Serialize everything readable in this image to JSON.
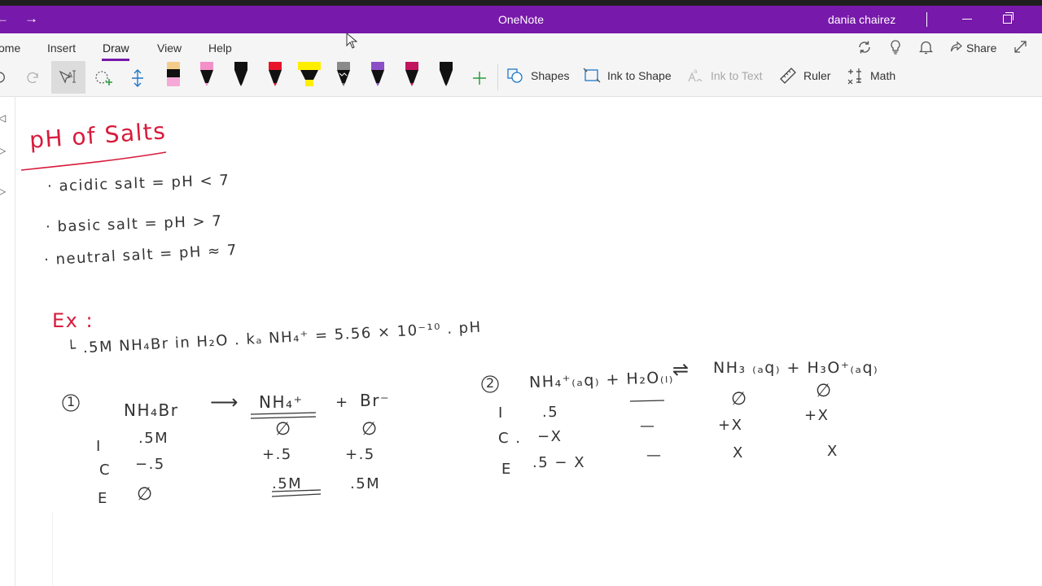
{
  "window": {
    "app_title": "OneNote",
    "user_name": "dania chairez"
  },
  "tabs": [
    {
      "label": "ome"
    },
    {
      "label": "Insert"
    },
    {
      "label": "Draw"
    },
    {
      "label": "View"
    },
    {
      "label": "Help"
    }
  ],
  "ribbon": {
    "share_label": "Share"
  },
  "tools": {
    "shapes": "Shapes",
    "ink_to_shape": "Ink to Shape",
    "ink_to_text": "Ink to Text",
    "ruler": "Ruler",
    "math": "Math"
  },
  "pens": [
    {
      "name": "highlighter-pink-yellow",
      "color": "#f6a8d6"
    },
    {
      "name": "pen-pink",
      "color": "#f48fc8"
    },
    {
      "name": "pen-black",
      "color": "#111111"
    },
    {
      "name": "pen-red",
      "color": "#e8142a"
    },
    {
      "name": "highlighter-yellow",
      "color": "#ffee00"
    },
    {
      "name": "pen-galaxy",
      "color": "#888888"
    },
    {
      "name": "pen-purple",
      "color": "#8b4fc7"
    },
    {
      "name": "pen-magenta",
      "color": "#c1155e"
    },
    {
      "name": "pen-black-2",
      "color": "#111111"
    }
  ],
  "notes": {
    "title": "pH of Salts",
    "line_acidic": "· acidic salt = pH < 7",
    "line_basic": "· basic salt = pH > 7",
    "line_neutral": "· neutral salt = pH ≈ 7",
    "ex_label": "Ex :",
    "problem": "└ .5M NH₄Br in H₂O .  kₐ NH₄⁺ = 5.56 × 10⁻¹⁰ .  pH",
    "step1_num": "1",
    "step1_reactant": "NH₄Br",
    "step1_arrow": "⟶",
    "step1_product1": "NH₄⁺",
    "step1_plus": "+",
    "step1_product2": "Br⁻",
    "ice1_i": "I",
    "ice1_c": "C",
    "ice1_e": "E",
    "ice1_i_val": ".5M",
    "ice1_c_val": "−.5",
    "ice1_e_val": "∅",
    "ice1_nh4_i": "∅",
    "ice1_nh4_c": "+.5",
    "ice1_nh4_e": ".5M",
    "ice1_br_i": "∅",
    "ice1_br_c": "+.5",
    "ice1_br_e": ".5M",
    "step2_num": "2",
    "step2_eq_left": "NH₄⁺₍ₐq₎ + H₂O₍ₗ₎",
    "step2_eq_arrow": "⇌",
    "step2_eq_right": "NH₃ ₍ₐq₎ + H₃O⁺₍ₐq₎",
    "ice2_i": "I",
    "ice2_c": "C .",
    "ice2_e": "E",
    "ice2_nh4_i": ".5",
    "ice2_nh4_c": "−X",
    "ice2_nh4_e": ".5 − X",
    "ice2_h2o_c": "—",
    "ice2_h2o_e": "—",
    "ice2_nh3_i": "∅",
    "ice2_nh3_c": "+X",
    "ice2_nh3_e": "X",
    "ice2_h3o_i": "∅",
    "ice2_h3o_c": "+X",
    "ice2_h3o_e": "X"
  }
}
